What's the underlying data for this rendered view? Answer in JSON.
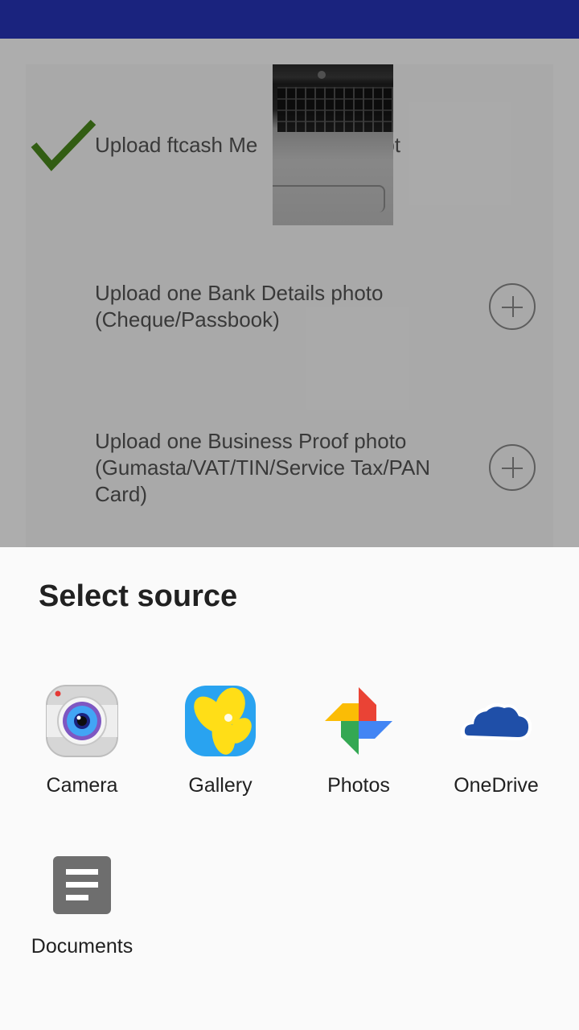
{
  "background": {
    "items": [
      {
        "label": "Upload ftcash Merchant Receipt",
        "visible_label_left": "Upload ftcash Me",
        "visible_label_right": "pt",
        "status": "done"
      },
      {
        "label": "Upload one Bank Details photo (Cheque/Passbook)"
      },
      {
        "label": "Upload one Business Proof photo (Gumasta/VAT/TIN/Service Tax/PAN Card)"
      }
    ]
  },
  "sheet": {
    "title": "Select source",
    "apps": [
      {
        "label": "Camera",
        "icon": "camera-icon"
      },
      {
        "label": "Gallery",
        "icon": "gallery-icon"
      },
      {
        "label": "Photos",
        "icon": "photos-pinwheel-icon"
      },
      {
        "label": "OneDrive",
        "icon": "onedrive-cloud-icon"
      },
      {
        "label": "Documents",
        "icon": "documents-icon"
      }
    ]
  },
  "colors": {
    "status_bar": "#1a237e",
    "check": "#4a8a1c",
    "scrim": "rgba(0,0,0,0.32)"
  }
}
